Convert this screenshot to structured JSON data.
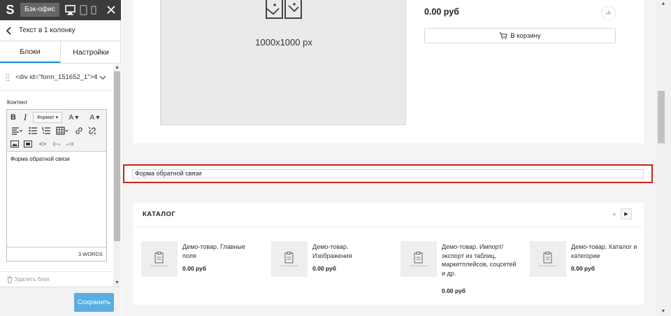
{
  "topbar": {
    "logo": "S",
    "backoffice_label": "Бэк-офис"
  },
  "block_header": {
    "title": "Текст в 1 колонку"
  },
  "tabs": [
    {
      "label": "Блоки",
      "active": true
    },
    {
      "label": "Настройки",
      "active": false
    }
  ],
  "element_select": {
    "value": "<div id=\"form_151652_1\">Ф..."
  },
  "content": {
    "label": "Контент",
    "toolbar": {
      "bold": "B",
      "italic": "I",
      "format": "Формат ▾",
      "text_color": "A ▾",
      "bg_color": "A ▾",
      "code": "<>"
    },
    "body_text": "Форма обратной связи",
    "word_count": "3 WORDS"
  },
  "delete_block_label": "Удалить блок",
  "save_label": "Сохранить",
  "product": {
    "image_label": "1000x1000 px",
    "price": "0.00 руб",
    "add_to_cart": "В корзину"
  },
  "form_block": {
    "text": "Форма обратной связи"
  },
  "catalog": {
    "title": "КАТАЛОГ",
    "thumb_caption": "Нет изображения",
    "items": [
      {
        "name": "Демо-товар. Главные поля",
        "price": "0.00 руб"
      },
      {
        "name": "Демо-товар. Изображения",
        "price": "0.00 руб"
      },
      {
        "name": "Демо-товар. Импорт/экспорт из таблиц, маркетплейсов, соцсетей и др.",
        "price": "0.00 руб"
      },
      {
        "name": "Демо-товар. Каталог и категории",
        "price": "0.00 руб"
      }
    ]
  },
  "colors": {
    "topbar_bg": "#3c3c3c",
    "accent": "#1a8fd8",
    "save_button": "#5aaee0",
    "highlight_border": "#c8231d"
  }
}
